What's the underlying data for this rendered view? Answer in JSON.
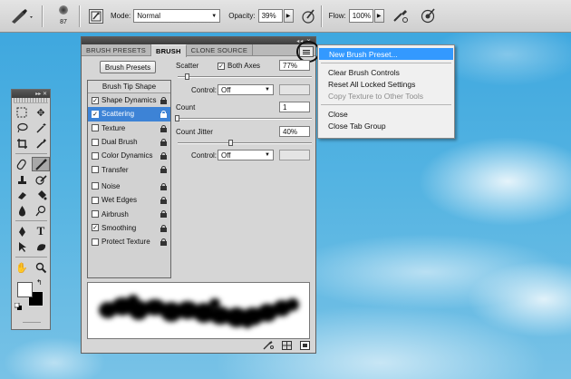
{
  "options_bar": {
    "brush_size": "87",
    "mode_label": "Mode:",
    "mode_value": "Normal",
    "opacity_label": "Opacity:",
    "opacity_value": "39%",
    "flow_label": "Flow:",
    "flow_value": "100%"
  },
  "brush_panel": {
    "tabs": [
      "BRUSH PRESETS",
      "BRUSH",
      "CLONE SOURCE"
    ],
    "active_tab": "BRUSH",
    "brush_presets_button": "Brush Presets",
    "options_header": "Brush Tip Shape",
    "options": [
      {
        "label": "Shape Dynamics",
        "checked": true,
        "selected": false
      },
      {
        "label": "Scattering",
        "checked": true,
        "selected": true
      },
      {
        "label": "Texture",
        "checked": false,
        "selected": false
      },
      {
        "label": "Dual Brush",
        "checked": false,
        "selected": false
      },
      {
        "label": "Color Dynamics",
        "checked": false,
        "selected": false
      },
      {
        "label": "Transfer",
        "checked": false,
        "selected": false
      },
      {
        "label": "Noise",
        "checked": false,
        "selected": false
      },
      {
        "label": "Wet Edges",
        "checked": false,
        "selected": false
      },
      {
        "label": "Airbrush",
        "checked": false,
        "selected": false
      },
      {
        "label": "Smoothing",
        "checked": true,
        "selected": false
      },
      {
        "label": "Protect Texture",
        "checked": false,
        "selected": false
      }
    ],
    "scatter": {
      "label": "Scatter",
      "both_axes_label": "Both Axes",
      "both_axes_checked": true,
      "value": "77%",
      "control_label": "Control:",
      "control_value": "Off"
    },
    "count": {
      "label": "Count",
      "value": "1"
    },
    "count_jitter": {
      "label": "Count Jitter",
      "value": "40%",
      "control_label": "Control:",
      "control_value": "Off"
    }
  },
  "flyout_menu": {
    "groups": [
      [
        {
          "label": "New Brush Preset...",
          "highlighted": true,
          "disabled": false
        }
      ],
      [
        {
          "label": "Clear Brush Controls",
          "highlighted": false,
          "disabled": false
        },
        {
          "label": "Reset All Locked Settings",
          "highlighted": false,
          "disabled": false
        },
        {
          "label": "Copy Texture to Other Tools",
          "highlighted": false,
          "disabled": true
        }
      ],
      [
        {
          "label": "Close",
          "highlighted": false,
          "disabled": false
        },
        {
          "label": "Close Tab Group",
          "highlighted": false,
          "disabled": false
        }
      ]
    ]
  },
  "colors": {
    "selection_blue": "#3d83d6",
    "menu_highlight": "#3399ff",
    "foreground_color": "#ffffff",
    "background_color": "#000000"
  }
}
